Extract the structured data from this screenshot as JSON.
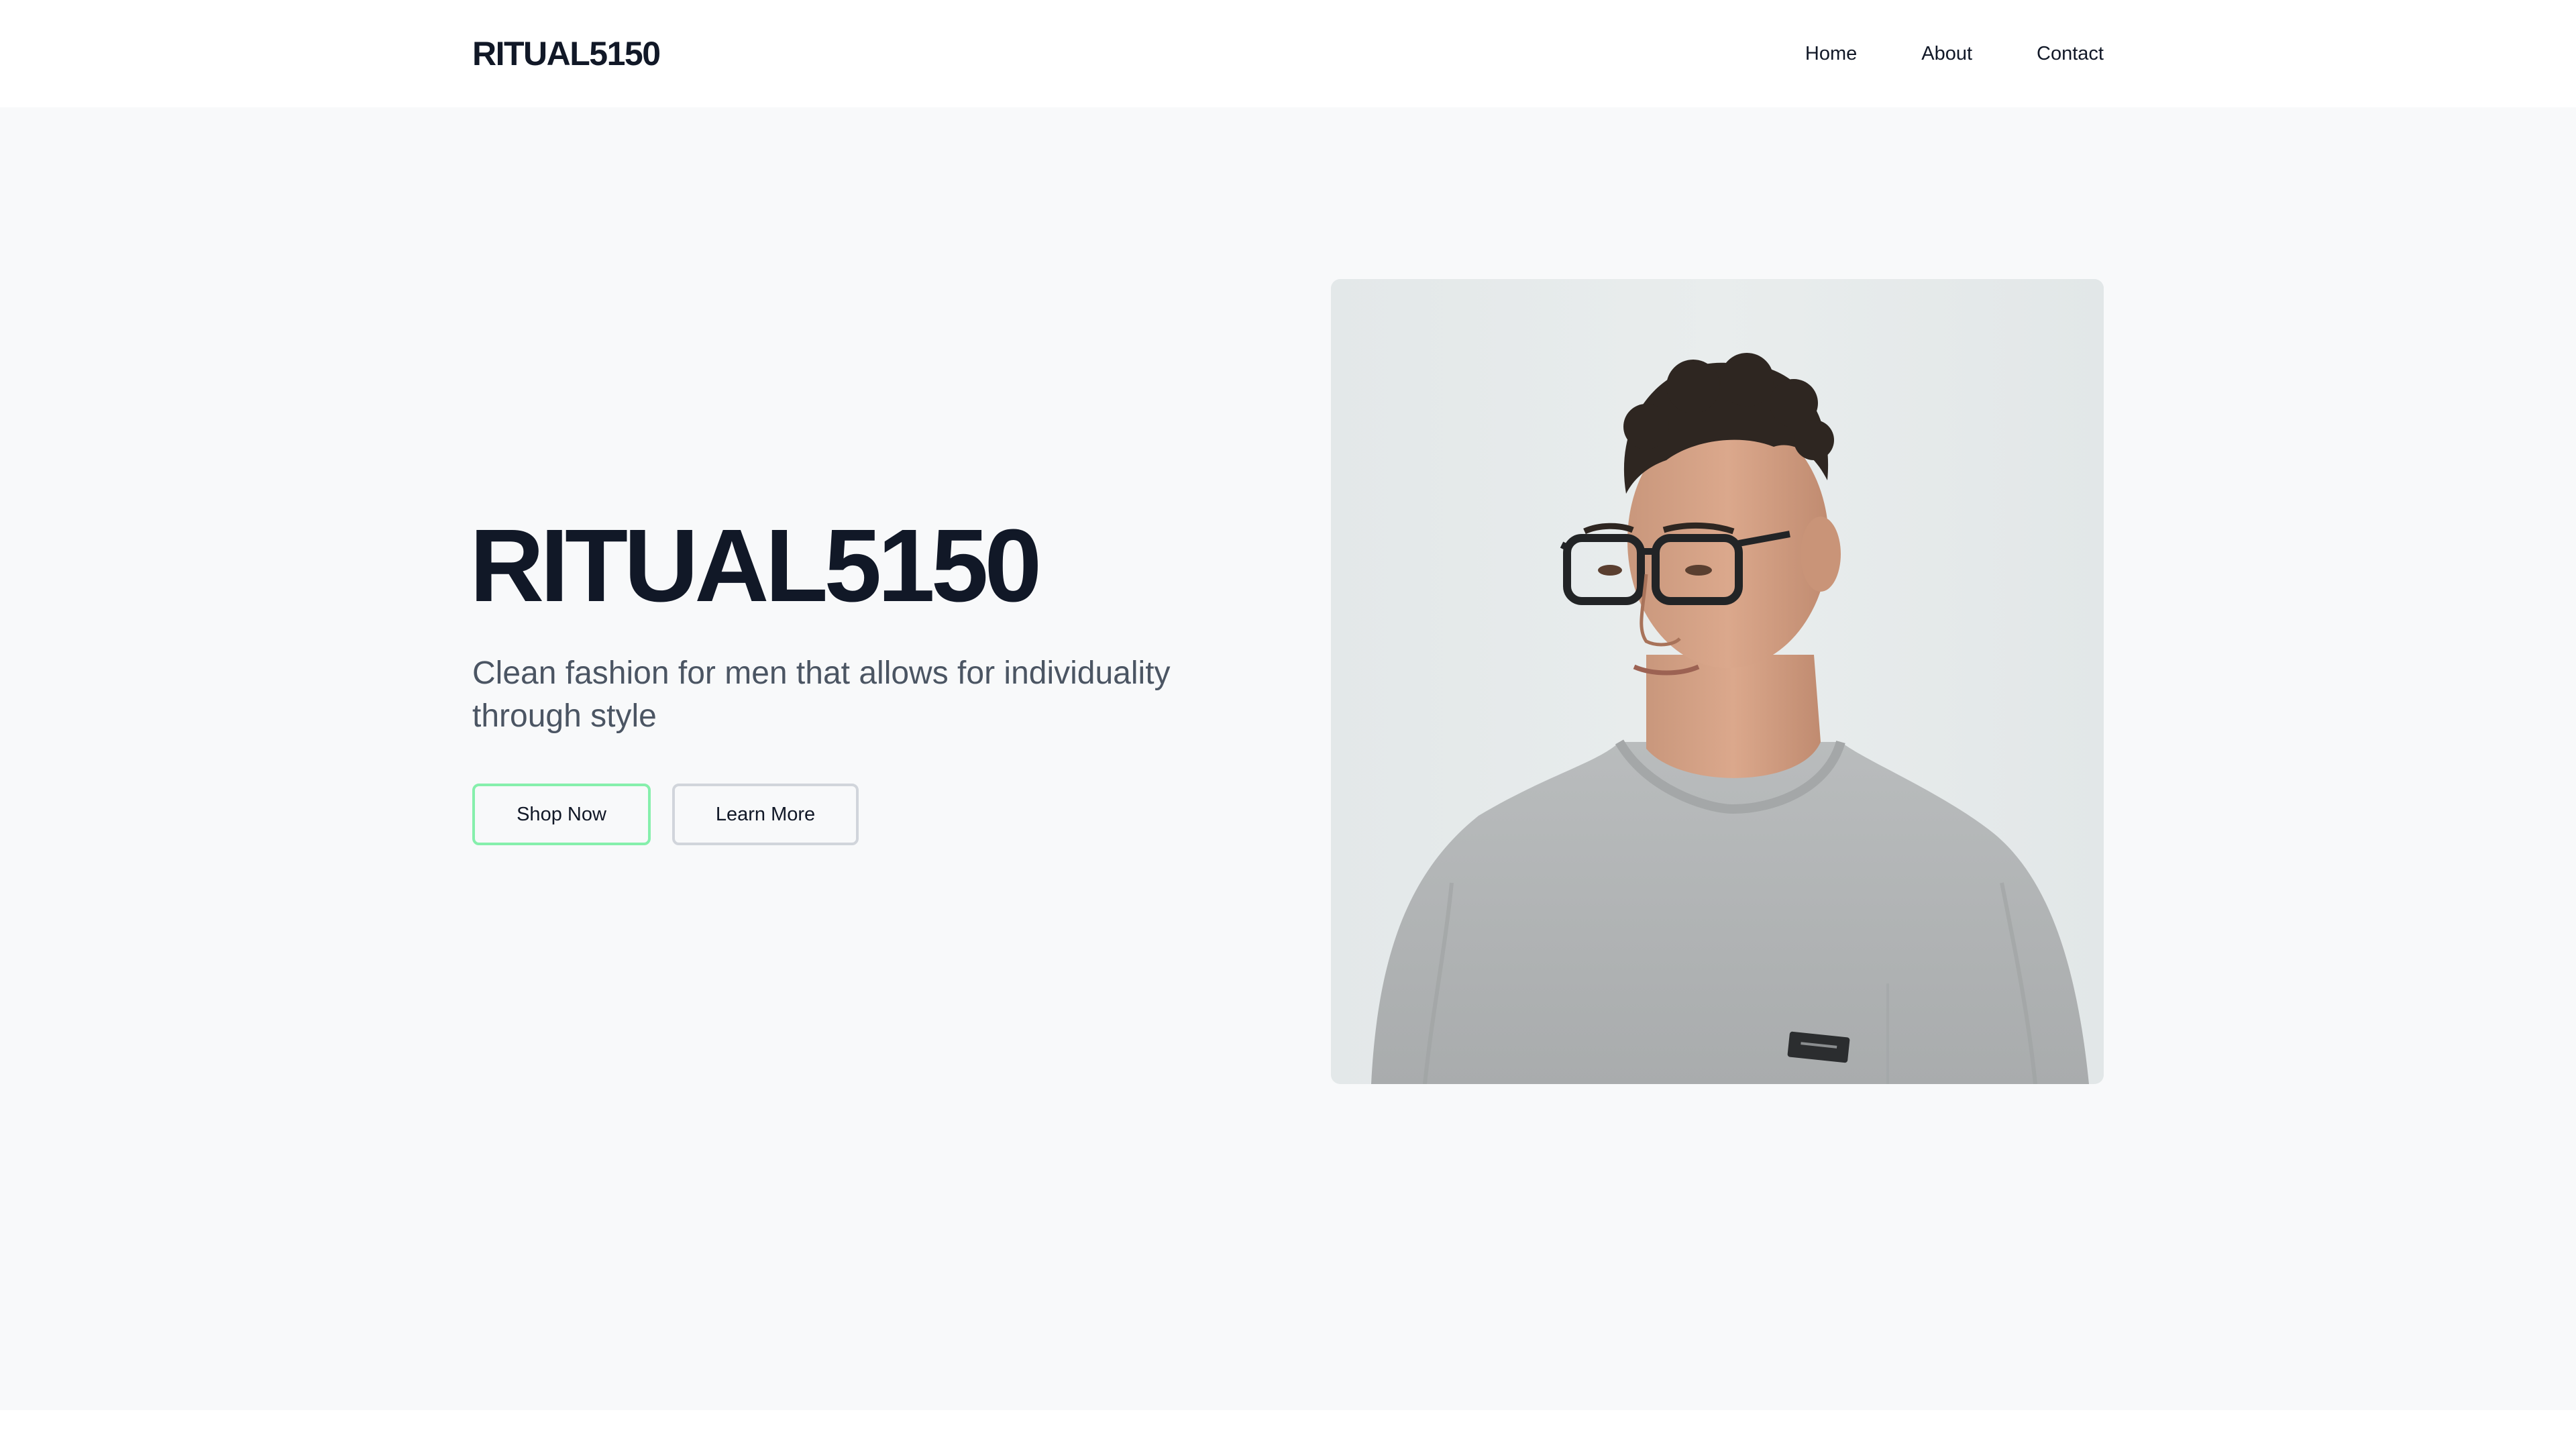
{
  "header": {
    "logo": "RITUAL5150",
    "nav": [
      {
        "label": "Home"
      },
      {
        "label": "About"
      },
      {
        "label": "Contact"
      }
    ]
  },
  "hero": {
    "title": "RITUAL5150",
    "subtitle": "Clean fashion for men that allows for individuality through style",
    "buttons": {
      "primary": "Shop Now",
      "secondary": "Learn More"
    },
    "image": {
      "subject": "man-wearing-glasses-and-grey-tshirt"
    }
  },
  "colors": {
    "text_dark": "#111827",
    "text_muted": "#4b5563",
    "hero_bg": "#f8f9fa",
    "primary_border": "#86efac",
    "secondary_border": "#d1d5db"
  }
}
